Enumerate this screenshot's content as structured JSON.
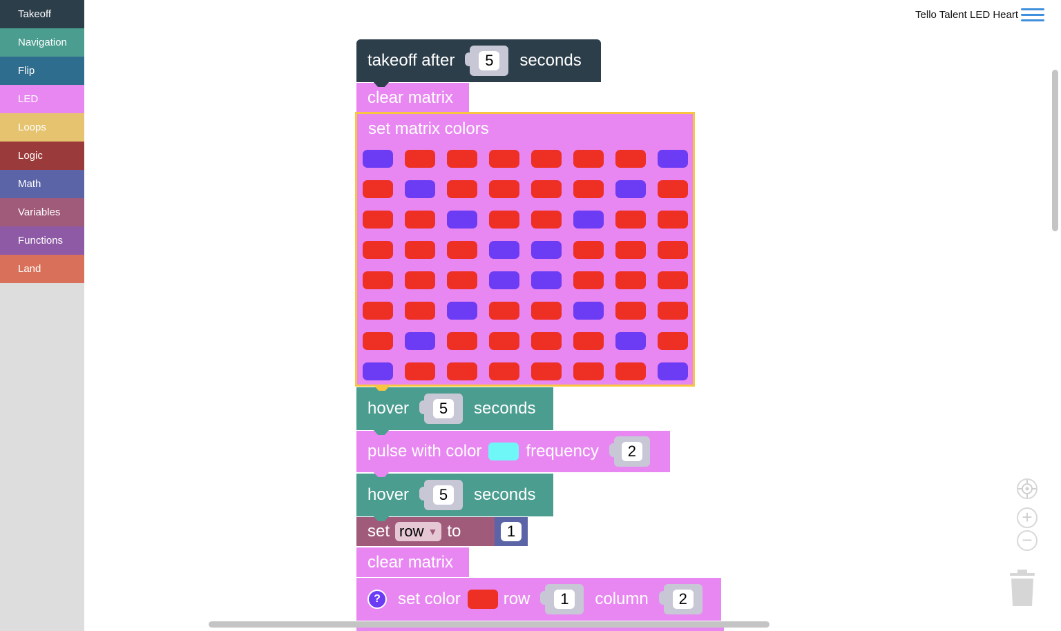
{
  "sidebar": {
    "categories": [
      {
        "label": "Takeoff",
        "color": "#2c3e4a"
      },
      {
        "label": "Navigation",
        "color": "#4a9d8f"
      },
      {
        "label": "Flip",
        "color": "#2f6d8e"
      },
      {
        "label": "LED",
        "color": "#e887f2"
      },
      {
        "label": "Loops",
        "color": "#e6c36f"
      },
      {
        "label": "Logic",
        "color": "#9b3a3a"
      },
      {
        "label": "Math",
        "color": "#5b64a6"
      },
      {
        "label": "Variables",
        "color": "#a05a7a"
      },
      {
        "label": "Functions",
        "color": "#8e5aa6"
      },
      {
        "label": "Land",
        "color": "#d9715a"
      }
    ]
  },
  "header": {
    "project_title": "Tello Talent LED Heart",
    "menu_icon": "hamburger-menu-icon"
  },
  "blocks": {
    "takeoff": {
      "label_before": "takeoff after",
      "value": "5",
      "label_after": "seconds"
    },
    "clear_matrix_1": {
      "label": "clear matrix"
    },
    "set_matrix": {
      "label": "set matrix colors",
      "grid": [
        [
          "p",
          "r",
          "r",
          "r",
          "r",
          "r",
          "r",
          "p"
        ],
        [
          "r",
          "p",
          "r",
          "r",
          "r",
          "r",
          "p",
          "r"
        ],
        [
          "r",
          "r",
          "p",
          "r",
          "r",
          "p",
          "r",
          "r"
        ],
        [
          "r",
          "r",
          "r",
          "p",
          "p",
          "r",
          "r",
          "r"
        ],
        [
          "r",
          "r",
          "r",
          "p",
          "p",
          "r",
          "r",
          "r"
        ],
        [
          "r",
          "r",
          "p",
          "r",
          "r",
          "p",
          "r",
          "r"
        ],
        [
          "r",
          "p",
          "r",
          "r",
          "r",
          "r",
          "p",
          "r"
        ],
        [
          "p",
          "r",
          "r",
          "r",
          "r",
          "r",
          "r",
          "p"
        ]
      ]
    },
    "hover_1": {
      "label_before": "hover",
      "value": "5",
      "label_after": "seconds"
    },
    "pulse": {
      "label_before": "pulse with color",
      "label_mid": "frequency",
      "value": "2"
    },
    "hover_2": {
      "label_before": "hover",
      "value": "5",
      "label_after": "seconds"
    },
    "set_var": {
      "label_before": "set",
      "dropdown": "row",
      "label_after": "to",
      "value": "1"
    },
    "clear_matrix_2": {
      "label": "clear matrix"
    },
    "set_color": {
      "help": "?",
      "label_before": "set color",
      "label_row": "row",
      "row_value": "1",
      "label_col": "column",
      "col_value": "2"
    }
  },
  "colors": {
    "led_red": "#ee2f24",
    "led_purple": "#6c3cf4",
    "pulse_cyan": "#6ff7f7",
    "set_color_red": "#ee2f24",
    "takeoff_block": "#2c3e4a",
    "nav_block": "#4a9d8f",
    "led_block": "#e887f2",
    "variables_block": "#a05a7a",
    "math_block": "#5b64a6",
    "selection_outline": "#f7c53f"
  },
  "controls": {
    "recenter": "crosshair-icon",
    "zoom_in": "zoom-in-icon",
    "zoom_out": "zoom-out-icon",
    "trash": "trash-icon"
  }
}
